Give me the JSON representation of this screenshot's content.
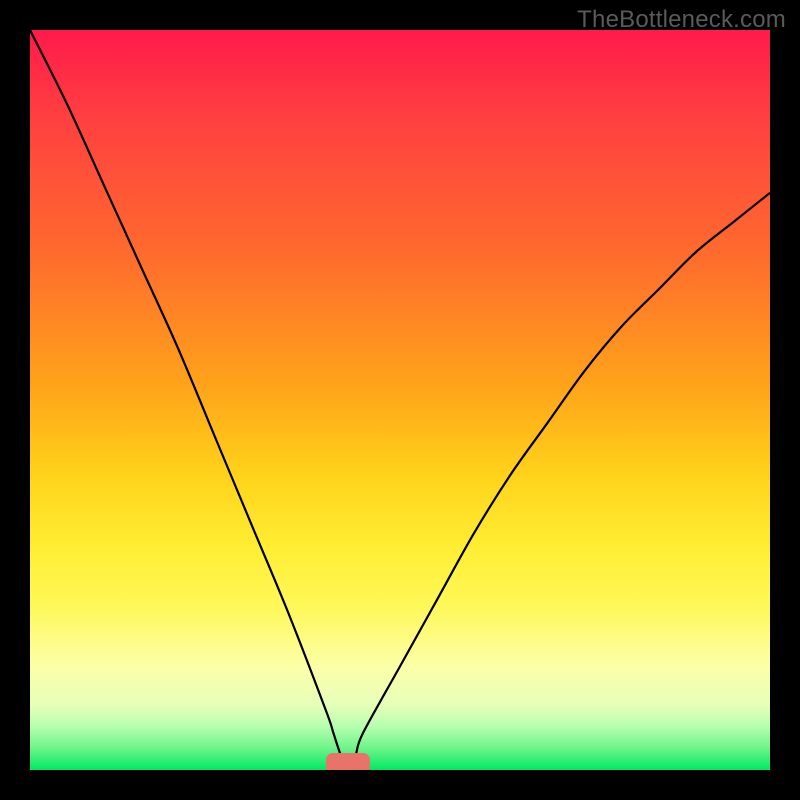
{
  "watermark": "TheBottleneck.com",
  "chart_data": {
    "type": "line",
    "title": "",
    "xlabel": "",
    "ylabel": "",
    "xlim": [
      0,
      100
    ],
    "ylim": [
      0,
      100
    ],
    "grid": false,
    "legend": false,
    "series": [
      {
        "name": "curve",
        "x": [
          0,
          5,
          10,
          15,
          20,
          25,
          30,
          35,
          40,
          41,
          42,
          43,
          44,
          45,
          50,
          55,
          60,
          65,
          70,
          75,
          80,
          85,
          90,
          95,
          100
        ],
        "values": [
          100,
          90,
          79,
          68,
          57,
          45,
          33,
          21,
          8,
          5,
          2,
          0,
          2,
          5,
          14,
          23,
          32,
          40,
          47,
          54,
          60,
          65,
          70,
          74,
          78
        ]
      }
    ],
    "marker": {
      "x_center": 43,
      "width": 6,
      "y": 0,
      "height": 2
    },
    "background_gradient": {
      "top": "#ff1a4b",
      "bottom": "#00e864"
    }
  },
  "layout": {
    "outer": 800,
    "inner": 740,
    "margin": 30
  }
}
